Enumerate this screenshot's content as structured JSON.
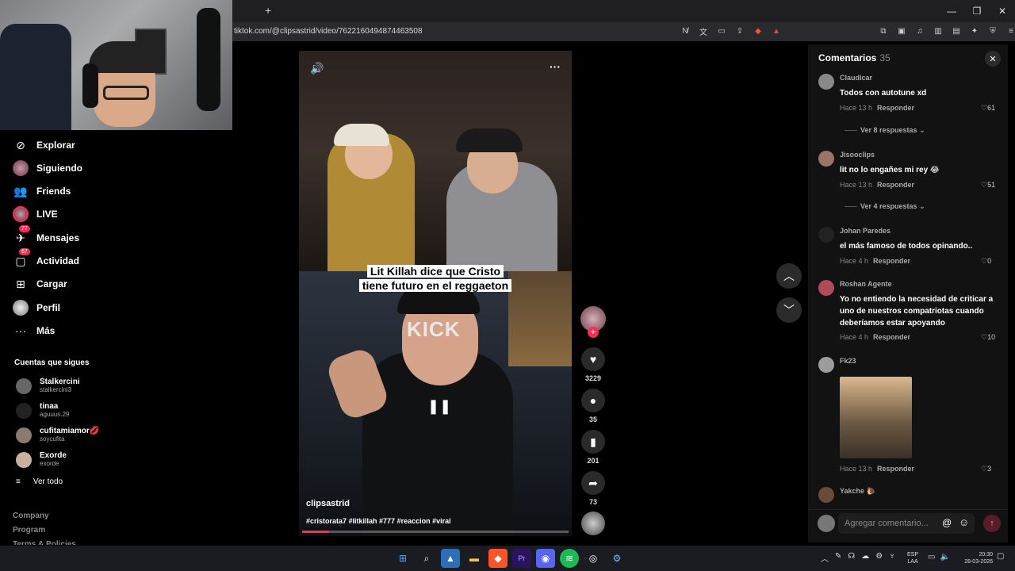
{
  "browser": {
    "new_tab_icon": "+",
    "window_controls": [
      "—",
      "❐",
      "✕"
    ],
    "url": "tiktok.com/@clipsastrid/video/7622160494874463508"
  },
  "sidebar": {
    "nav": [
      {
        "label": "Explorar",
        "icon": "compass-icon"
      },
      {
        "label": "Siguiendo",
        "icon": "following-avatar-icon"
      },
      {
        "label": "Friends",
        "icon": "friends-icon"
      },
      {
        "label": "LIVE",
        "icon": "live-icon"
      },
      {
        "label": "Mensajes",
        "icon": "messages-icon",
        "badge": "77"
      },
      {
        "label": "Actividad",
        "icon": "activity-icon",
        "badge": "67"
      },
      {
        "label": "Cargar",
        "icon": "upload-icon"
      },
      {
        "label": "Perfil",
        "icon": "profile-avatar-icon"
      },
      {
        "label": "Más",
        "icon": "more-icon"
      }
    ],
    "following_title": "Cuentas que sigues",
    "following": [
      {
        "name": "Stalkercini",
        "handle": "stalkercini3"
      },
      {
        "name": "tinaa",
        "handle": "aguuus.29"
      },
      {
        "name": "cufitamiamor💋",
        "handle": "soycufita"
      },
      {
        "name": "Exorde",
        "handle": "exorde"
      }
    ],
    "see_all": "Ver todo",
    "footer": [
      "Company",
      "Program",
      "Terms & Policies"
    ]
  },
  "video": {
    "caption_line1": "Lit Killah dice que Cristo",
    "caption_line2": "tiene futuro en el reggaeton",
    "watermark": "KICK",
    "author": "clipsastrid",
    "hashtags": "#cristorata7 #litkillah  #777 #reaccion #viral",
    "progress": 0.1
  },
  "actions": {
    "likes": "3229",
    "comments": "35",
    "saves": "201",
    "shares": "73"
  },
  "comments_panel": {
    "title": "Comentarios",
    "count": "35",
    "comments": [
      {
        "user": "Claudicar",
        "text": "Todos con autotune xd",
        "time": "Hace 13 h",
        "reply": "Responder",
        "likes": "61",
        "replies": "Ver 8 respuestas"
      },
      {
        "user": "Jisooclips",
        "text": "lit no lo engañes mi rey 😂",
        "time": "Hace 13 h",
        "reply": "Responder",
        "likes": "51",
        "replies": "Ver 4 respuestas"
      },
      {
        "user": "Johan Paredes",
        "text": "el más famoso de todos opinando..",
        "time": "Hace 4 h",
        "reply": "Responder",
        "likes": "0"
      },
      {
        "user": "Roshan Agente",
        "text": "Yo no entiendo la necesidad de criticar a uno de nuestros compatriotas cuando deberíamos estar apoyando",
        "time": "Hace 4 h",
        "reply": "Responder",
        "likes": "10"
      },
      {
        "user": "Fk23",
        "text": "",
        "time": "Hace 13 h",
        "reply": "Responder",
        "likes": "3"
      },
      {
        "user": "Yakche 🐌",
        "text": ""
      }
    ],
    "input_placeholder": "Agregar comentario..."
  },
  "taskbar": {
    "lang_line1": "ESP",
    "lang_line2": "LAA",
    "time": "20:30",
    "date": "28-03-2026"
  },
  "colors": {
    "accent": "#fe2c55",
    "panel_bg": "#121212"
  }
}
